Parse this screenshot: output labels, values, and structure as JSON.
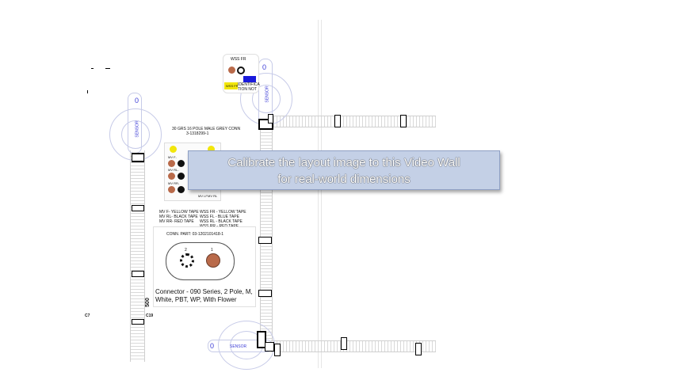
{
  "overlay": {
    "calibrate_line1": "Calibrate the layout image to this Video Wall",
    "calibrate_line2": "for real-world dimensions"
  },
  "top_connector": {
    "title": "WSS FR",
    "label1": "IDENTIFICA",
    "label2": "TION NOT",
    "yellow_tag": "WSS FR"
  },
  "grey_conn": {
    "title": "30 GRS 16 POLE MALE GREY CONN",
    "part": "3-1318299-1",
    "rows": [
      "MV F-",
      "MV RL-",
      "MV RR-",
      "MV LF",
      "MV RL"
    ]
  },
  "tape_legend": {
    "col1": [
      "MV F-    YELLOW TAPE",
      "MV RL- BLACK TAPE",
      "MV RR- RED TAPE"
    ],
    "col2": [
      "WSS FR -   YELLOW TAPE",
      "WSS FL -    BLUE TAPE",
      "WSS RL -    BLACK TAPE",
      "WSS RR -    RED TAPE"
    ]
  },
  "connector_box": {
    "part_label": "CONN. PART: 03-1202101418-1",
    "pin_left": "2",
    "pin_right": "1",
    "desc1": "Connector - 090 Series, 2 Pole, M,",
    "desc2": "White, PBT, WP, With Flower"
  },
  "labels": {
    "dim_500": "500",
    "c7": "C7",
    "c19": "C19",
    "zero": "0",
    "sensor_top": "SENSOR",
    "sensor_left": "SENSOR",
    "sensor_bottom": "SENSOR"
  },
  "colors": {
    "overlay_bg": "#c4d0e6",
    "zero_blue": "#3b3bd6",
    "copper": "#b96a4a",
    "yellow": "#f2e60c",
    "blue_box": "#1a1adb"
  }
}
